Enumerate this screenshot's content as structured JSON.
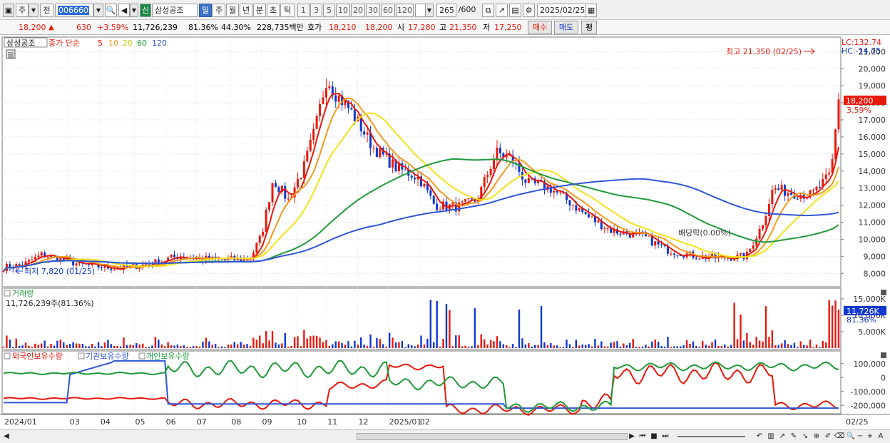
{
  "toolbar": {
    "type_label": "주",
    "dropdown_arrow": "▼",
    "prev_label": "전",
    "code": "006660",
    "new_badge": "신",
    "company": "삼성공조",
    "periods": [
      "일",
      "주",
      "월",
      "년",
      "분",
      "초",
      "틱"
    ],
    "active_period": "일",
    "intervals": [
      "1",
      "3",
      "5",
      "10",
      "20",
      "30",
      "60",
      "120"
    ],
    "count": "265",
    "count_total": "/600",
    "date": "2025/02/25"
  },
  "quote": {
    "price": "18,200",
    "up_arrow": "▲",
    "change": "630",
    "change_pct": "+3.59%",
    "volume": "11,726,239",
    "vol_ratio": "81.36%",
    "turnover": "44.30%",
    "amount": "228,735백만",
    "hoga_label": "호가",
    "ask": "18,210",
    "bid": "18,200",
    "open_label": "시",
    "open": "17,280",
    "high_label": "고",
    "high": "21,350",
    "low_label": "저",
    "low": "17,250",
    "buy_button": "매수",
    "sell_button": "매도",
    "eval_button": "평"
  },
  "price_panel": {
    "stock_box": "삼성공조",
    "legend_prefix": "종가 단순",
    "ma_labels": [
      "5",
      "10",
      "20",
      "60",
      "120"
    ],
    "lc": "LC:132.74",
    "hc": "HC:-14.75",
    "high_note": "최고 21,350 (02/25)",
    "low_note": "최저 7,820 (01/25)",
    "dividend_note": "배당락(0.00%)",
    "current_price": "18,200",
    "current_pct": "3.59%"
  },
  "volume_panel": {
    "title": "거래량",
    "sub": "11,726,239주(81.36%)",
    "current": "11,726K",
    "current_pct": "81.36%"
  },
  "holdings_panel": {
    "foreign": "외국인보유수량",
    "institution": "기관보유수량",
    "individual": "개인보유수량"
  },
  "x_axis": [
    "2024/01",
    "03",
    "04",
    "05",
    "06",
    "07",
    "08",
    "09",
    "10",
    "11",
    "12",
    "2025/01",
    "02",
    "02/25"
  ],
  "chart_data": [
    {
      "type": "candlestick",
      "title": "",
      "y_ticks": [
        8000,
        9000,
        10000,
        11000,
        12000,
        13000,
        14000,
        15000,
        16000,
        17000,
        18000,
        19000,
        20000,
        21000
      ],
      "ylim": [
        7300,
        21600
      ],
      "series": [
        {
          "name": "5",
          "color": "#e8180c"
        },
        {
          "name": "10",
          "color": "#f39a1b"
        },
        {
          "name": "20",
          "color": "#f2e21a"
        },
        {
          "name": "60",
          "color": "#1f9a3a"
        },
        {
          "name": "120",
          "color": "#3056d8"
        }
      ],
      "price_path": [
        [
          2024.0,
          8350
        ],
        [
          2024.05,
          8500
        ],
        [
          2024.1,
          9100
        ],
        [
          2024.15,
          8850
        ],
        [
          2024.2,
          8500
        ],
        [
          2024.3,
          8300
        ],
        [
          2024.38,
          8550
        ],
        [
          2024.45,
          9000
        ],
        [
          2024.55,
          8800
        ],
        [
          2024.64,
          8850
        ],
        [
          2024.67,
          10200
        ],
        [
          2024.7,
          13500
        ],
        [
          2024.74,
          12300
        ],
        [
          2024.78,
          14200
        ],
        [
          2024.81,
          16500
        ],
        [
          2024.84,
          19500
        ],
        [
          2024.86,
          18600
        ],
        [
          2024.9,
          17600
        ],
        [
          2024.96,
          15400
        ],
        [
          2025.02,
          14200
        ],
        [
          2025.08,
          13600
        ],
        [
          2025.12,
          12000
        ],
        [
          2025.18,
          11900
        ],
        [
          2025.23,
          12300
        ],
        [
          2025.28,
          15100
        ],
        [
          2025.32,
          14700
        ],
        [
          2025.36,
          13300
        ],
        [
          2025.42,
          13000
        ],
        [
          2025.47,
          12200
        ],
        [
          2025.52,
          11300
        ],
        [
          2025.58,
          10500
        ],
        [
          2025.66,
          10200
        ],
        [
          2025.72,
          9400
        ],
        [
          2025.8,
          9000
        ],
        [
          2025.86,
          8900
        ],
        [
          2025.93,
          9000
        ],
        [
          2025.97,
          10800
        ],
        [
          2026.0,
          13000
        ],
        [
          2026.05,
          12700
        ],
        [
          2026.1,
          12600
        ],
        [
          2026.15,
          13800
        ],
        [
          2026.17,
          18200
        ]
      ]
    },
    {
      "type": "bar",
      "title": "",
      "y_ticks": [
        5000,
        10000,
        15000
      ],
      "unit": "K"
    },
    {
      "type": "line",
      "title": "",
      "y_ticks": [
        100000,
        0,
        -100000,
        -200000
      ]
    }
  ]
}
